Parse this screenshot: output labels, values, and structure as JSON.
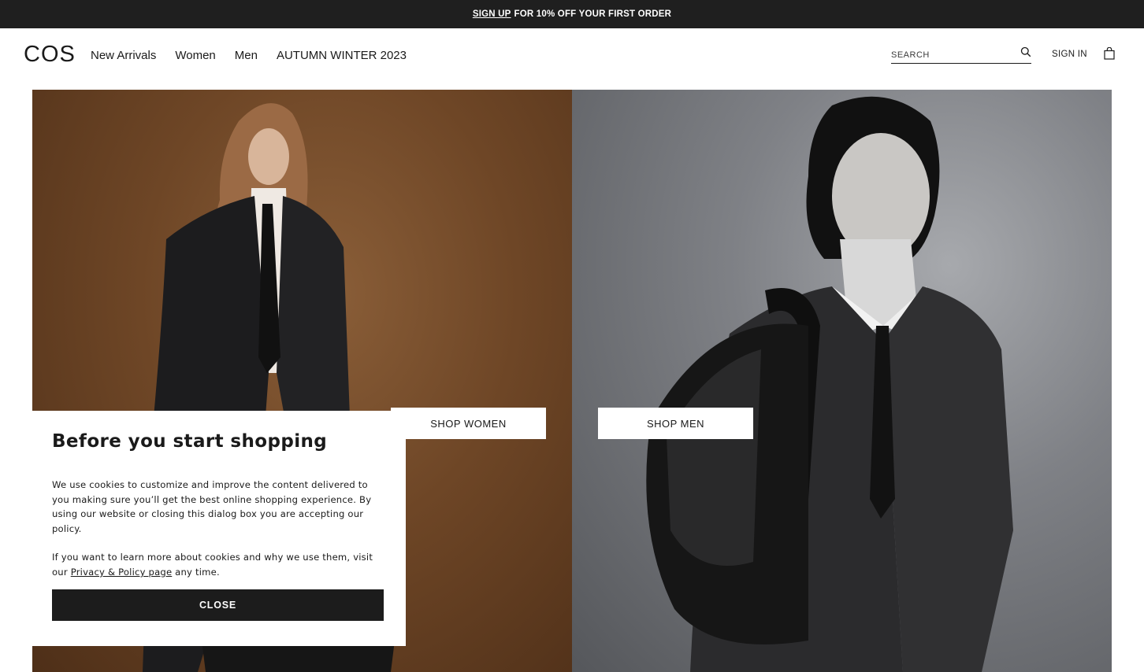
{
  "promo": {
    "link_text": "SIGN UP",
    "text": "FOR 10% OFF YOUR FIRST ORDER"
  },
  "header": {
    "logo": "COS",
    "nav": [
      {
        "label": "New Arrivals"
      },
      {
        "label": "Women"
      },
      {
        "label": "Men"
      },
      {
        "label": "AUTUMN WINTER 2023"
      }
    ],
    "search_placeholder": "SEARCH",
    "sign_in": "SIGN IN"
  },
  "hero": {
    "women_button": "SHOP WOMEN",
    "men_button": "SHOP MEN"
  },
  "cookie_dialog": {
    "title": "Before you start shopping",
    "paragraph1": "We use cookies to customize and improve the content delivered to you making sure you’ll get the best online shopping experience. By using our website or closing this dialog box you are accepting our policy.",
    "paragraph2_before": "If you want to learn more about cookies and why we use them, visit our ",
    "privacy_link": "Privacy & Policy page",
    "paragraph2_after": " any time.",
    "close_button": "CLOSE"
  },
  "colors": {
    "dark": "#1f1f1f",
    "women_bg": "#6e4626",
    "men_bg": "#7f8186"
  }
}
